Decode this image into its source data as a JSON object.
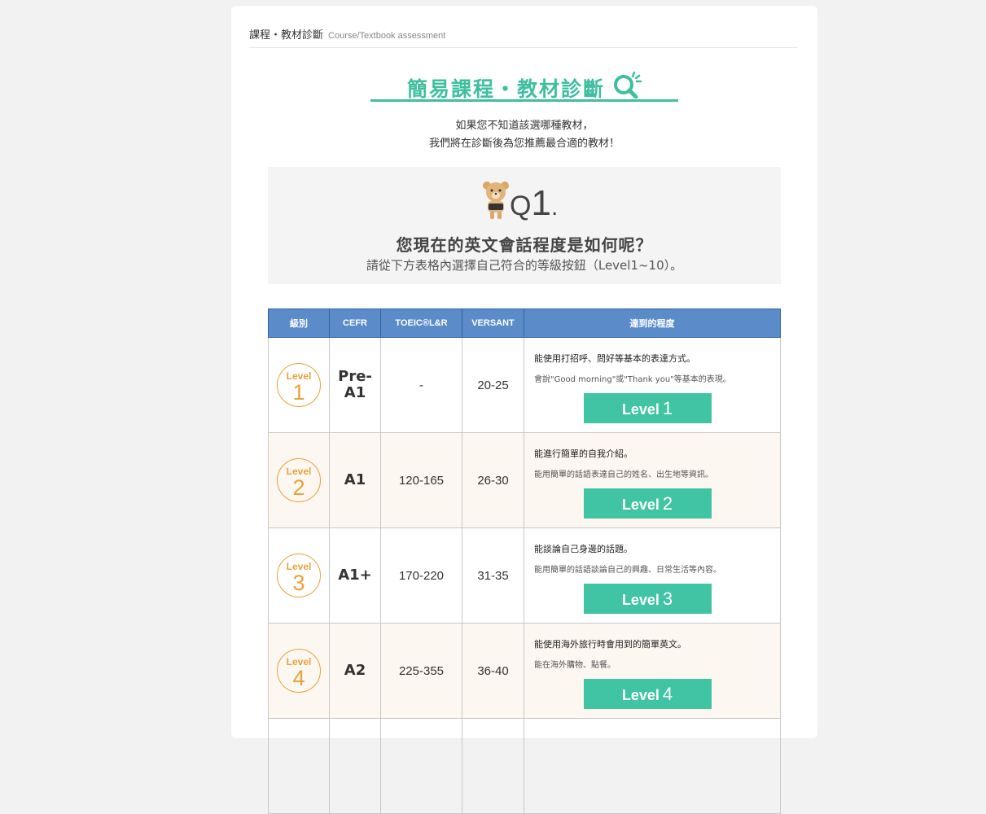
{
  "breadcrumb": {
    "title": "課程・教材診斷",
    "subtitle": "Course/Textbook assessment"
  },
  "hero": {
    "title": "簡易課程・教材診斷",
    "intro_line1": "如果您不知道該選哪種教材，",
    "intro_line2": "我們將在診斷後為您推薦最合適的教材！"
  },
  "question": {
    "q": "Q",
    "number": "1",
    "dot": ".",
    "text": "您現在的英文會話程度是如何呢？",
    "sub": "請從下方表格內選擇自己符合的等級按鈕（Level1~10）。"
  },
  "table": {
    "headers": [
      "級別",
      "CEFR",
      "TOEIC®L&R",
      "VERSANT",
      "達到的程度"
    ],
    "rows": [
      {
        "badge_label": "Level",
        "badge_num": "1",
        "cefr": "Pre-A1",
        "toeic": "-",
        "versant": "20-25",
        "desc_main": "能使用打招呼、問好等基本的表達方式。",
        "desc_sub": "會說\"Good morning\"或\"Thank you\"等基本的表現。",
        "button_label": "Level",
        "button_num": "1"
      },
      {
        "badge_label": "Level",
        "badge_num": "2",
        "cefr": "A1",
        "toeic": "120-165",
        "versant": "26-30",
        "desc_main": "能進行簡單的自我介紹。",
        "desc_sub": "能用簡單的話語表達自己的姓名、出生地等資訊。",
        "button_label": "Level",
        "button_num": "2"
      },
      {
        "badge_label": "Level",
        "badge_num": "3",
        "cefr": "A1+",
        "toeic": "170-220",
        "versant": "31-35",
        "desc_main": "能談論自己身邊的話題。",
        "desc_sub": "能用簡單的話語談論自己的興趣、日常生活等內容。",
        "button_label": "Level",
        "button_num": "3"
      },
      {
        "badge_label": "Level",
        "badge_num": "4",
        "cefr": "A2",
        "toeic": "225-355",
        "versant": "36-40",
        "desc_main": "能使用海外旅行時會用到的簡單英文。",
        "desc_sub": "能在海外購物、點餐。",
        "button_label": "Level",
        "button_num": "4"
      }
    ]
  },
  "colors": {
    "accent": "#40c4a4",
    "header_blue": "#5b8cc9",
    "badge_orange": "#e8a23a"
  },
  "icons": {
    "hero": "magnifier-icon",
    "mascot": "bear-mascot-icon"
  }
}
